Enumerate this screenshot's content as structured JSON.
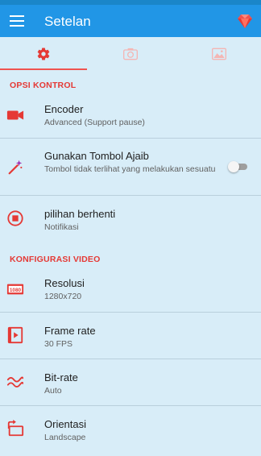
{
  "app": {
    "title": "Setelan",
    "colors": {
      "app_bar": "#2196e6",
      "accent": "#e53935",
      "background": "#d8edf8"
    }
  },
  "tabs": [
    {
      "icon": "gear-icon",
      "active": true
    },
    {
      "icon": "camera-icon",
      "active": false
    },
    {
      "icon": "image-icon",
      "active": false
    }
  ],
  "sections": {
    "kontrol": {
      "title": "OPSI KONTROL"
    },
    "video": {
      "title": "KONFIGURASI VIDEO"
    }
  },
  "items": {
    "encoder": {
      "label": "Encoder",
      "value": "Advanced (Support pause)",
      "icon": "video-camera-icon"
    },
    "magic": {
      "label": "Gunakan Tombol Ajaib",
      "value": "Tombol tidak terlihat yang melakukan sesuatu",
      "icon": "magic-wand-icon",
      "toggle_on": false
    },
    "stop": {
      "label": "pilihan berhenti",
      "value": "Notifikasi",
      "icon": "stop-circle-icon"
    },
    "resolusi": {
      "label": "Resolusi",
      "value": "1280x720",
      "icon": "hd-icon",
      "badge": "1080"
    },
    "framerate": {
      "label": "Frame rate",
      "value": "30 FPS",
      "icon": "film-icon"
    },
    "bitrate": {
      "label": "Bit-rate",
      "value": "Auto",
      "icon": "wave-icon"
    },
    "orientasi": {
      "label": "Orientasi",
      "value": "Landscape",
      "icon": "rotate-icon"
    }
  }
}
